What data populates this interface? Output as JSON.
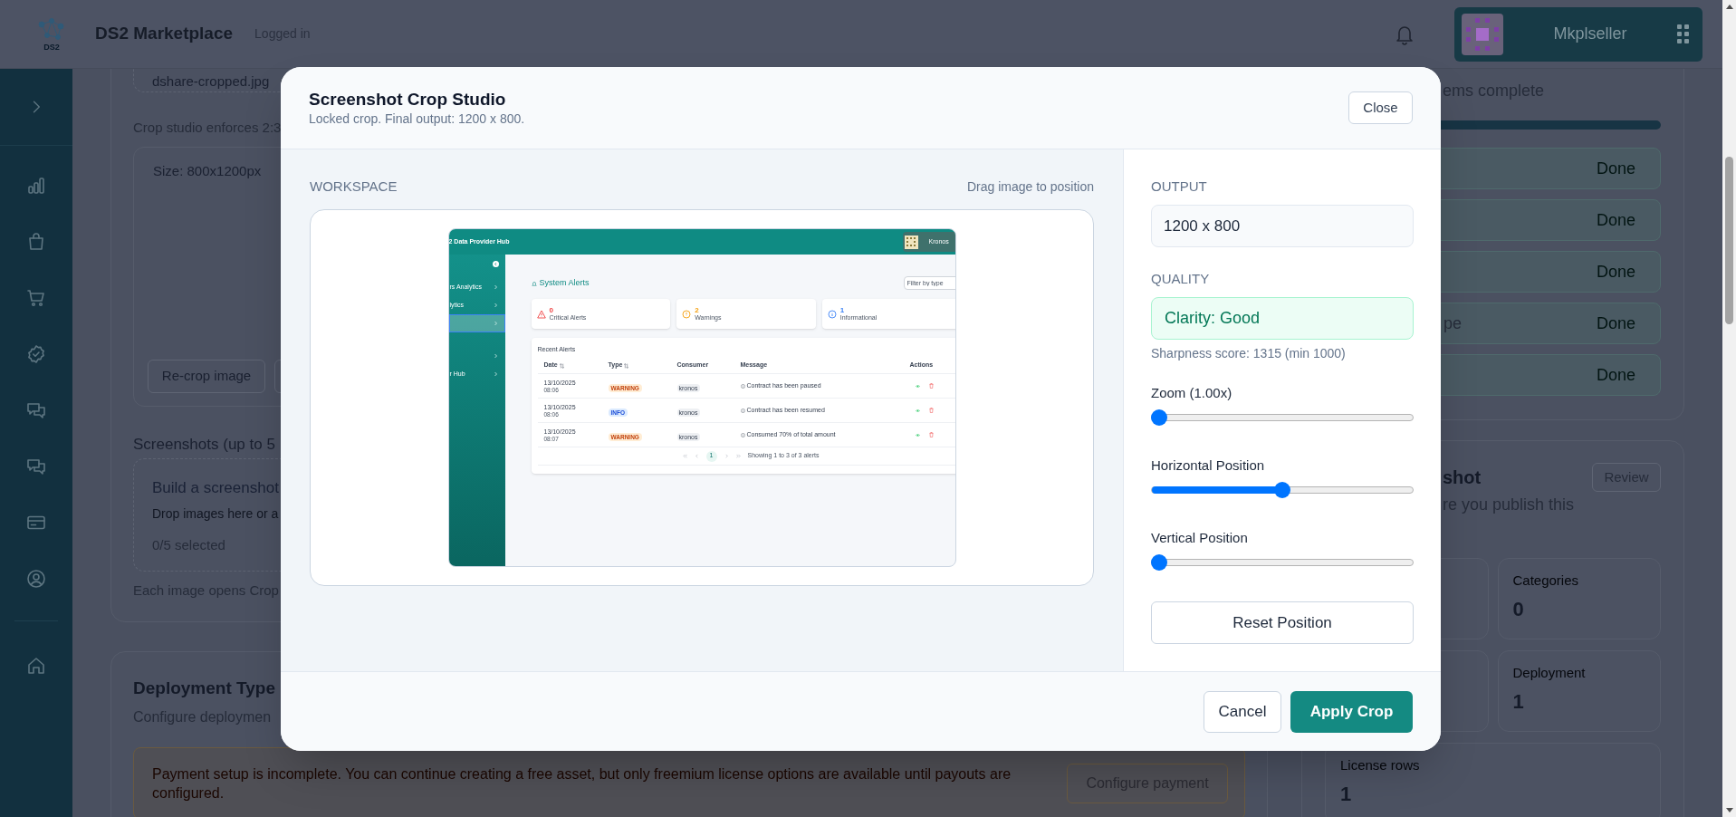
{
  "header": {
    "logo_text": "DS2",
    "brand": "DS2 Marketplace",
    "status": "Logged in",
    "user": "Mkplseller"
  },
  "file_card": {
    "filename": "dshare-cropped.jpg",
    "hint": "Crop studio enforces 2:3",
    "size": "Size: 800x1200px",
    "button": "Re-crop image"
  },
  "screenshots": {
    "heading": "Screenshots (up to 5",
    "dropzone_title": "Build a screenshot",
    "dropzone_text": "Drop images here or a",
    "count": "0/5 selected",
    "note": "Each image opens Crop"
  },
  "deployment": {
    "title": "Deployment Type",
    "subtitle": "Configure deploymen",
    "notice": "Payment setup is incomplete. You can continue creating a free asset, but only freemium license options are available until payouts are configured.",
    "button": "Configure payment"
  },
  "checklist": {
    "summary": "ems complete",
    "level": 1,
    "items": [
      {
        "status": "Done"
      },
      {
        "status": "Done"
      },
      {
        "status": "Done"
      },
      {
        "label": "pe",
        "status": "Done"
      },
      {
        "status": "Done"
      }
    ]
  },
  "review": {
    "title": "shot",
    "subtitle": "re you publish this",
    "button": "Review",
    "stats": [
      {
        "label": "Categories",
        "value": "0"
      },
      {
        "label": "Deployment",
        "value": "1"
      },
      {
        "label": "License rows",
        "value": "1"
      }
    ]
  },
  "modal": {
    "title": "Screenshot Crop Studio",
    "subtitle": "Locked crop. Final output: 1200 x 800.",
    "close": "Close",
    "workspace_label": "WORKSPACE",
    "workspace_hint": "Drag image to position",
    "output_label": "OUTPUT",
    "output_value": "1200 x 800",
    "quality_label": "QUALITY",
    "clarity": "Clarity: Good",
    "sharpness": "Sharpness score: 1315 (min 1000)",
    "sliders": [
      {
        "label": "Zoom (1.00x)",
        "level": 0
      },
      {
        "label": "Horizontal Position",
        "level": 0.5
      },
      {
        "label": "Vertical Position",
        "level": 0
      }
    ],
    "reset": "Reset Position",
    "cancel": "Cancel",
    "apply": "Apply Crop"
  },
  "preview": {
    "app_title": "2 Data Provider Hub",
    "user": "Kronos",
    "nav": [
      {
        "label": "rs Analytics",
        "selected": false
      },
      {
        "label": "lytics",
        "selected": false
      },
      {
        "selected": true
      },
      {
        "selected": false
      },
      {
        "label": "r Hub",
        "selected": false
      }
    ],
    "heading": "System Alerts",
    "filter_placeholder": "Filter by type",
    "stats": [
      {
        "kind": "critical",
        "value": "0",
        "label": "Critical Alerts"
      },
      {
        "kind": "warning",
        "value": "2",
        "label": "Warnings"
      },
      {
        "kind": "info",
        "value": "1",
        "label": "Informational"
      }
    ],
    "table": {
      "title": "Recent Alerts",
      "columns": [
        {
          "label": "Date",
          "sortable": true
        },
        {
          "label": "Type",
          "sortable": true
        },
        {
          "label": "Consumer",
          "sortable": false
        },
        {
          "label": "Message",
          "sortable": false
        },
        {
          "label": "Actions",
          "sortable": false
        }
      ],
      "rows": [
        {
          "date": "13/10/2025",
          "time": "08:06",
          "type": "WARNING",
          "kind": "warning",
          "consumer": "kronos",
          "message": "Contract has been paused"
        },
        {
          "date": "13/10/2025",
          "time": "08:06",
          "type": "INFO",
          "kind": "info",
          "consumer": "kronos",
          "message": "Contract has been resumed"
        },
        {
          "date": "13/10/2025",
          "time": "08:07",
          "type": "WARNING",
          "kind": "warning",
          "consumer": "kronos",
          "message": "Consumed 70% of total amount"
        }
      ]
    },
    "pagination": {
      "page": "1",
      "summary": "Showing 1 to 3 of 3 alerts"
    }
  }
}
